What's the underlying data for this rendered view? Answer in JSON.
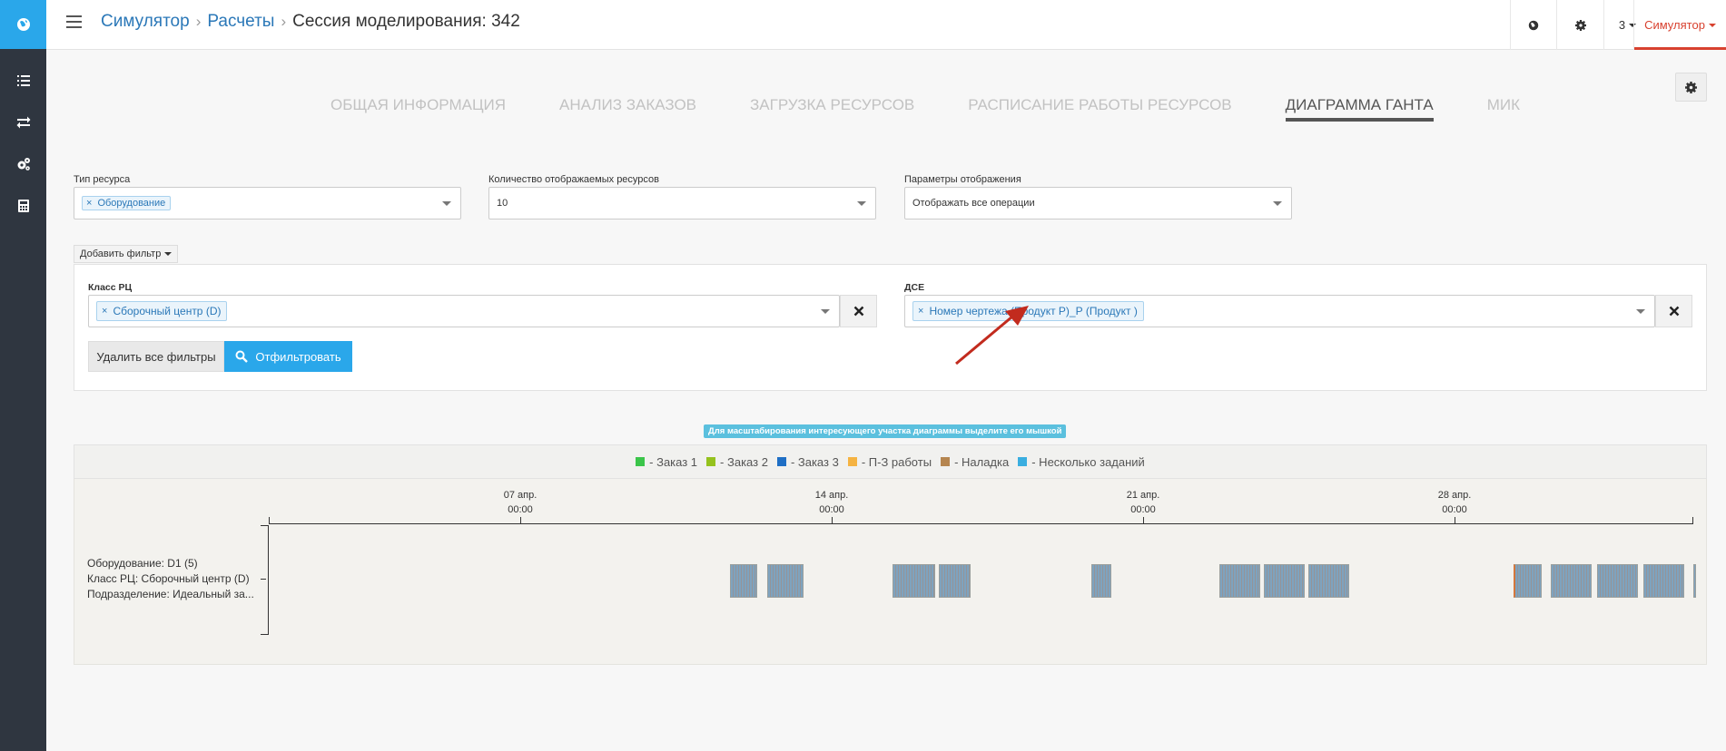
{
  "breadcrumb": {
    "items": [
      "Симулятор",
      "Расчеты"
    ],
    "current": "Сессия моделирования: 342"
  },
  "header": {
    "lang_icon": "globe-icon",
    "settings_icon": "gear-icon",
    "counter": "3",
    "user": "Симулятор"
  },
  "sidebar": {
    "items": [
      "list-icon",
      "exchange-icon",
      "cogs-icon",
      "calculator-icon"
    ]
  },
  "tabs": [
    {
      "label": "ОБЩАЯ ИНФОРМАЦИЯ",
      "active": false
    },
    {
      "label": "АНАЛИЗ ЗАКАЗОВ",
      "active": false
    },
    {
      "label": "ЗАГРУЗКА РЕСУРСОВ",
      "active": false
    },
    {
      "label": "РАСПИСАНИЕ РАБОТЫ РЕСУРСОВ",
      "active": false
    },
    {
      "label": "ДИАГРАММА ГАНТА",
      "active": true
    },
    {
      "label": "МИК",
      "active": false
    }
  ],
  "form": {
    "resource_type": {
      "label": "Тип ресурса",
      "tag": "Оборудование"
    },
    "resource_count": {
      "label": "Количество отображаемых ресурсов",
      "value": "10"
    },
    "display_params": {
      "label": "Параметры отображения",
      "value": "Отображать все операции"
    },
    "add_filter": "Добавить фильтр"
  },
  "filters": {
    "rc_class": {
      "label": "Класс РЦ",
      "tag": "Сборочный центр (D)"
    },
    "dse": {
      "label": "ДСЕ",
      "tag": "Номер чертежа (Продукт Р)_Р (Продукт )"
    },
    "clear_all": "Удалить все фильтры",
    "apply": "Отфильтровать"
  },
  "hint": "Для масштабирования интересующего участка диаграммы выделите его мышкой",
  "legend": [
    {
      "label": "- Заказ 1",
      "color": "#3bc54a"
    },
    {
      "label": "- Заказ 2",
      "color": "#95c21e"
    },
    {
      "label": "- Заказ 3",
      "color": "#1f6fc5"
    },
    {
      "label": "- П-З работы",
      "color": "#f5b342"
    },
    {
      "label": "- Наладка",
      "color": "#b5854f"
    },
    {
      "label": "- Несколько заданий",
      "color": "#3aaee0"
    }
  ],
  "gantt": {
    "resource_lines": [
      "Оборудование: D1 (5)",
      "Класс РЦ: Сборочный центр (D)",
      "Подразделение: Идеальный за..."
    ],
    "ticks": [
      {
        "date": "07 апр.",
        "time": "00:00"
      },
      {
        "date": "14 апр.",
        "time": "00:00"
      },
      {
        "date": "21 апр.",
        "time": "00:00"
      },
      {
        "date": "28 апр.",
        "time": "00:00"
      }
    ],
    "tasks": [
      {
        "start": "2025-04-11 17:00",
        "end": "2025-04-12 08:00"
      },
      {
        "start": "2025-04-12 13:00",
        "end": "2025-04-13 09:00"
      },
      {
        "start": "2025-04-15 09:00",
        "end": "2025-04-16 08:00"
      },
      {
        "start": "2025-04-16 10:00",
        "end": "2025-04-17 03:00"
      },
      {
        "start": "2025-04-19 20:00",
        "end": "2025-04-20 07:00"
      },
      {
        "start": "2025-04-22 17:00",
        "end": "2025-04-23 15:00"
      },
      {
        "start": "2025-04-23 17:00",
        "end": "2025-04-24 15:00"
      },
      {
        "start": "2025-04-24 17:00",
        "end": "2025-04-25 15:00"
      },
      {
        "start": "2025-04-29 08:00",
        "end": "2025-04-29 23:00"
      },
      {
        "start": "2025-04-30 04:00",
        "end": "2025-05-01 02:00"
      },
      {
        "start": "2025-05-01 05:00",
        "end": "2025-05-02 03:00"
      },
      {
        "start": "2025-05-02 06:00",
        "end": "2025-05-03 04:00"
      },
      {
        "start": "2025-05-03 09:00",
        "end": "2025-05-03 12:00"
      }
    ]
  }
}
